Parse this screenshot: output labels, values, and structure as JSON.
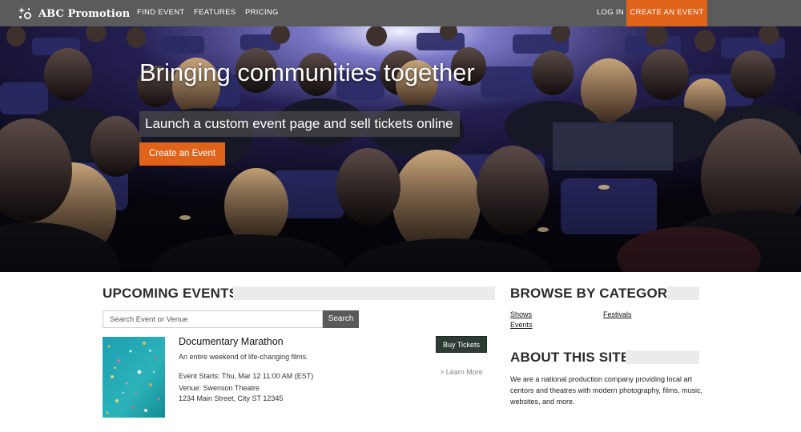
{
  "nav": {
    "brand": "ABC Promotion",
    "links": [
      "FIND EVENT",
      "FEATURES",
      "PRICING"
    ],
    "login": "LOG IN",
    "cta": "CREATE AN EVENT"
  },
  "hero": {
    "title": "Bringing communities together",
    "subtitle": "Launch a custom event page and sell tickets online",
    "button": "Create an Event"
  },
  "upcoming": {
    "heading": "UPCOMING EVENTS",
    "search": {
      "placeholder": "Search Event or Venue",
      "value": "",
      "button": "Search"
    },
    "event": {
      "title": "Documentary Marathon",
      "description": "An entire weekend of life-changing films.",
      "starts": "Event Starts: Thu, Mar 12 11:00 AM (EST)",
      "venue": "Venue: Swenson Theatre",
      "address": "1234 Main Street, City ST 12345",
      "buy": "Buy Tickets",
      "learn_more": "> Learn More"
    }
  },
  "browse": {
    "heading": "BROWSE BY CATEGORY",
    "categories": [
      "Shows",
      "Events",
      "Festivals"
    ]
  },
  "about": {
    "heading": "ABOUT THIS SITE",
    "text": "We are a national production company providing local art centors and theatres with modern photography, films, music, websites, and more."
  },
  "colors": {
    "nav_bg": "#5b5b5b",
    "accent": "#e0631a",
    "buy_button": "#2d3b33",
    "heading_bar": "#ebebeb"
  },
  "icons": {
    "brand": "sparkle-logo-icon"
  }
}
